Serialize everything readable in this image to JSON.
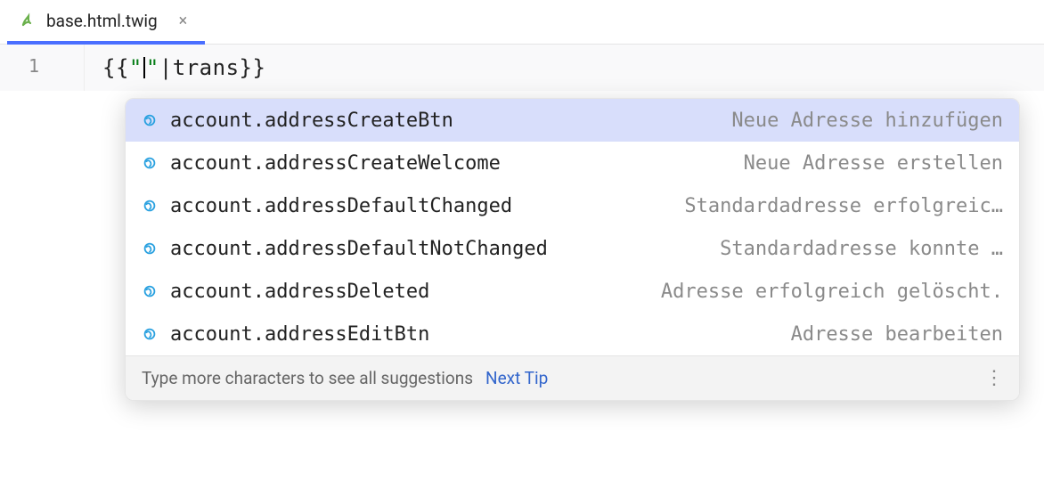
{
  "tab": {
    "filename": "base.html.twig"
  },
  "editor": {
    "line_number": "1",
    "code": {
      "open": "{{ ",
      "string_open": "\"",
      "string_close": "\"",
      "pipe": "|",
      "fn": "trans",
      "close": " }}"
    }
  },
  "suggestions": [
    {
      "key": "account.addressCreateBtn",
      "desc": "Neue Adresse hinzufügen",
      "selected": true
    },
    {
      "key": "account.addressCreateWelcome",
      "desc": "Neue Adresse erstellen",
      "selected": false
    },
    {
      "key": "account.addressDefaultChanged",
      "desc": "Standardadresse erfolgreic…",
      "selected": false
    },
    {
      "key": "account.addressDefaultNotChanged",
      "desc": "Standardadresse konnte …",
      "selected": false
    },
    {
      "key": "account.addressDeleted",
      "desc": "Adresse erfolgreich gelöscht.",
      "selected": false
    },
    {
      "key": "account.addressEditBtn",
      "desc": "Adresse bearbeiten",
      "selected": false
    }
  ],
  "footer": {
    "hint": "Type more characters to see all suggestions",
    "tip_label": "Next Tip"
  }
}
